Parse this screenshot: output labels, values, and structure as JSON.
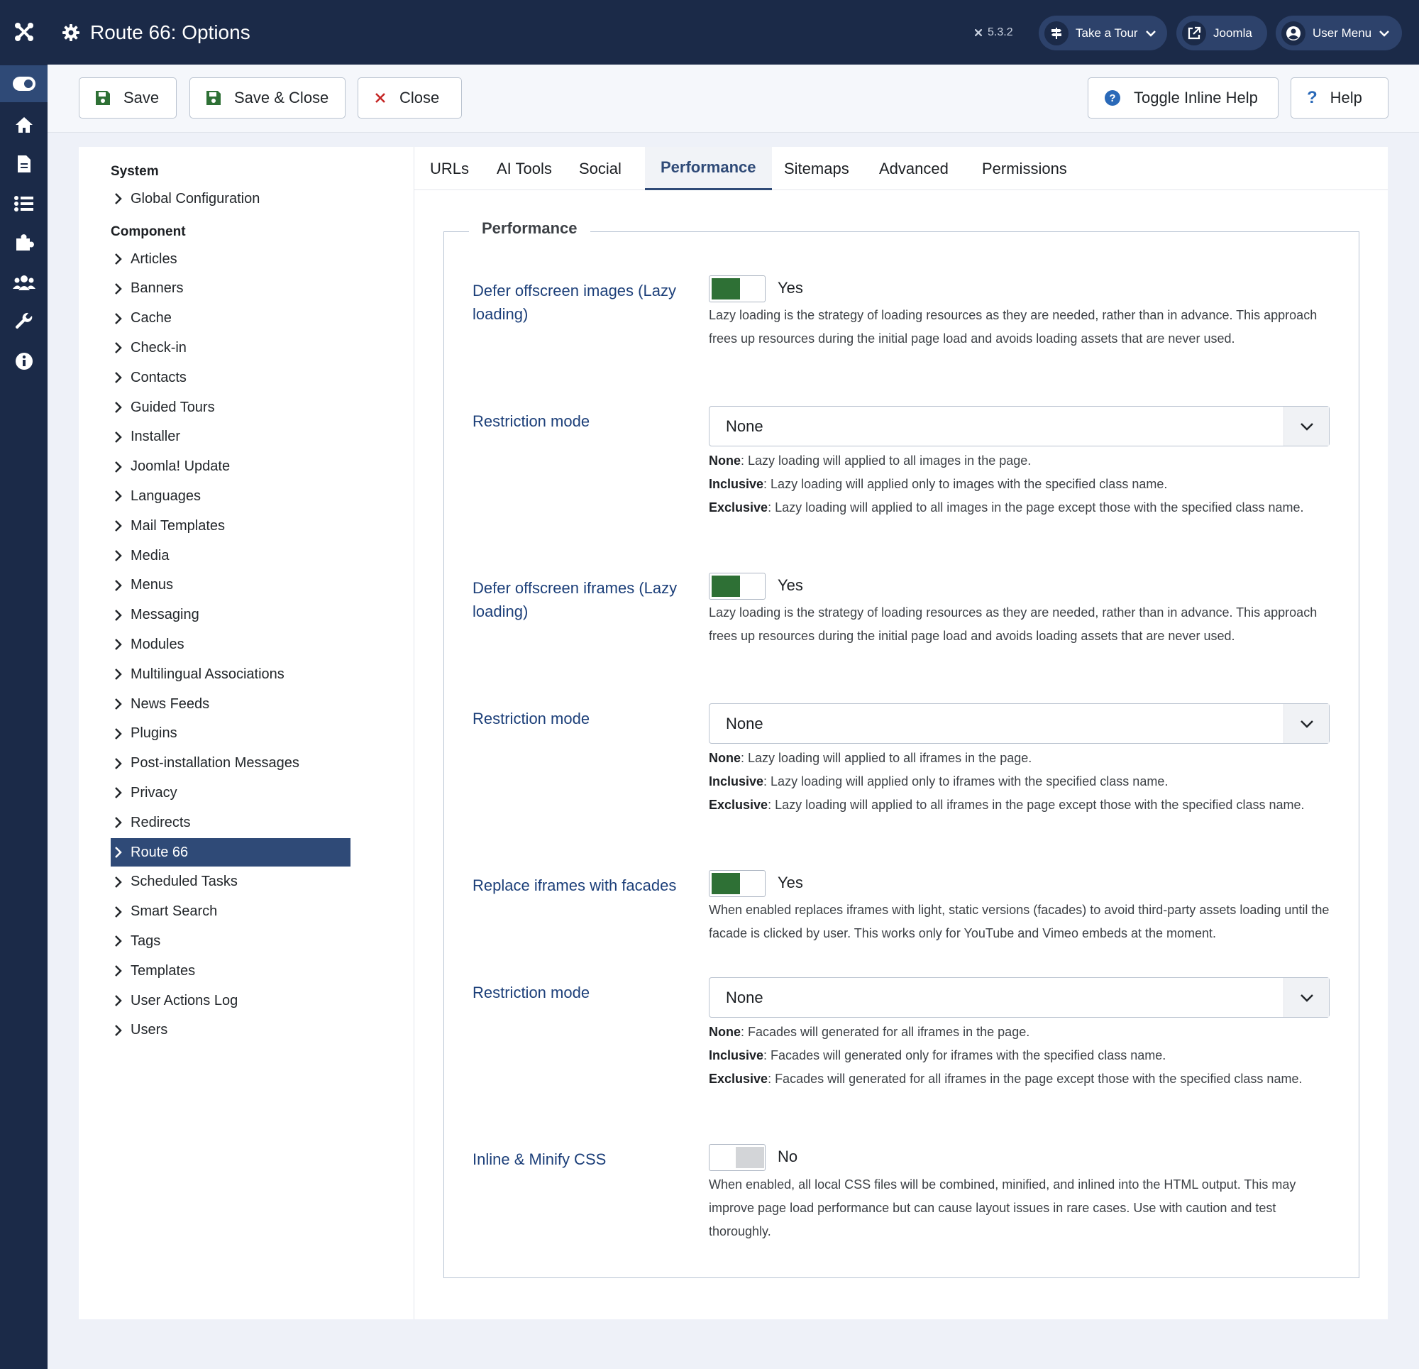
{
  "header": {
    "title": "Route 66: Options",
    "version": "5.3.2",
    "take_tour": "Take a Tour",
    "joomla": "Joomla",
    "user_menu": "User Menu"
  },
  "toolbar": {
    "save": "Save",
    "save_close": "Save & Close",
    "close": "Close",
    "toggle_help": "Toggle Inline Help",
    "help": "Help"
  },
  "sidebar": {
    "system_heading": "System",
    "system_items": [
      "Global Configuration"
    ],
    "component_heading": "Component",
    "component_items": [
      "Articles",
      "Banners",
      "Cache",
      "Check-in",
      "Contacts",
      "Guided Tours",
      "Installer",
      "Joomla! Update",
      "Languages",
      "Mail Templates",
      "Media",
      "Menus",
      "Messaging",
      "Modules",
      "Multilingual Associations",
      "News Feeds",
      "Plugins",
      "Post-installation Messages",
      "Privacy",
      "Redirects",
      "Route 66",
      "Scheduled Tasks",
      "Smart Search",
      "Tags",
      "Templates",
      "User Actions Log",
      "Users"
    ],
    "active_item": "Route 66"
  },
  "tabs": [
    "URLs",
    "AI Tools",
    "Social",
    "Performance",
    "Sitemaps",
    "Advanced",
    "Permissions"
  ],
  "active_tab": "Performance",
  "performance": {
    "legend": "Performance",
    "fields": [
      {
        "label": "Defer offscreen images (Lazy loading)",
        "value": "Yes",
        "desc": "Lazy loading is the strategy of loading resources as they are needed, rather than in advance. This approach frees up resources during the initial page load and avoids loading assets that are never used."
      },
      {
        "label": "Restriction mode",
        "value": "None",
        "none_key": "None",
        "none_text": ": Lazy loading will applied to all images in the page.",
        "incl_key": "Inclusive",
        "incl_text": ": Lazy loading will applied only to images with the specified class name.",
        "excl_key": "Exclusive",
        "excl_text": ": Lazy loading will applied to all images in the page except those with the specified class name."
      },
      {
        "label": "Defer offscreen iframes (Lazy loading)",
        "value": "Yes",
        "desc": "Lazy loading is the strategy of loading resources as they are needed, rather than in advance. This approach frees up resources during the initial page load and avoids loading assets that are never used."
      },
      {
        "label": "Restriction mode",
        "value": "None",
        "none_key": "None",
        "none_text": ": Lazy loading will applied to all iframes in the page.",
        "incl_key": "Inclusive",
        "incl_text": ": Lazy loading will applied only to iframes with the specified class name.",
        "excl_key": "Exclusive",
        "excl_text": ": Lazy loading will applied to all iframes in the page except those with the specified class name."
      },
      {
        "label": "Replace iframes with facades",
        "value": "Yes",
        "desc": "When enabled replaces iframes with light, static versions (facades) to avoid third-party assets loading until the facade is clicked by user. This works only for YouTube and Vimeo embeds at the moment."
      },
      {
        "label": "Restriction mode",
        "value": "None",
        "none_key": "None",
        "none_text": ": Facades will generated for all iframes in the page.",
        "incl_key": "Inclusive",
        "incl_text": ": Facades will generated only for iframes with the specified class name.",
        "excl_key": "Exclusive",
        "excl_text": ": Facades will generated for all iframes in the page except those with the specified class name."
      },
      {
        "label": "Inline & Minify CSS",
        "value": "No",
        "desc": "When enabled, all local CSS files will be combined, minified, and inlined into the HTML output. This may improve page load performance but can cause layout issues in rare cases. Use with caution and test thoroughly."
      }
    ]
  },
  "colors": {
    "header_bg": "#1b2a48",
    "accent": "#2f4a77",
    "toggle_on": "#2e7035",
    "label_blue": "#1c3f79",
    "close_red": "#c52827"
  }
}
